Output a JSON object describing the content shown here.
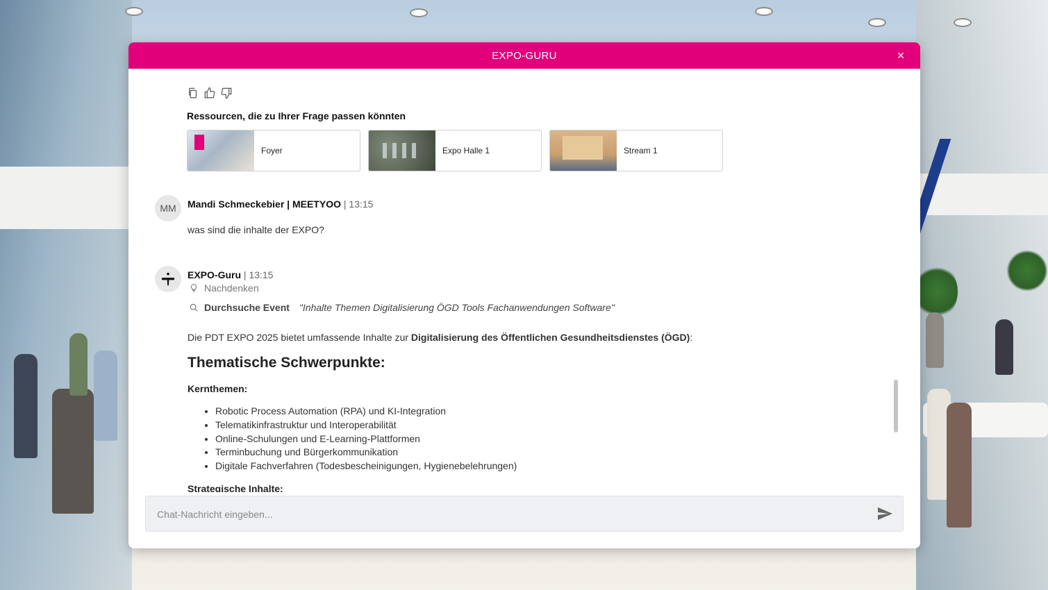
{
  "modal": {
    "title": "EXPO-GURU",
    "close_symbol": "×",
    "accent_color": "#e2007a"
  },
  "feedback_icons": [
    "copy-icon",
    "thumbs-up-icon",
    "thumbs-down-icon"
  ],
  "resources": {
    "heading": "Ressourcen, die zu Ihrer Frage passen könnten",
    "items": [
      {
        "label": "Foyer"
      },
      {
        "label": "Expo Halle 1"
      },
      {
        "label": "Stream 1"
      }
    ]
  },
  "user_message": {
    "avatar": "MM",
    "author": "Mandi Schmeckebier | MEETYOO",
    "separator": "|",
    "time": "13:15",
    "text": "was sind die inhalte der EXPO?"
  },
  "bot_message": {
    "author": "EXPO-Guru",
    "separator": "|",
    "time": "13:15",
    "steps": {
      "thinking": "Nachdenken",
      "search_label": "Durchsuche Event",
      "search_query": "\"Inhalte Themen Digitalisierung ÖGD Tools Fachanwendungen Software\""
    },
    "intro_prefix": "Die PDT EXPO 2025 bietet umfassende Inhalte zur ",
    "intro_bold": "Digitalisierung des Öffentlichen Gesundheitsdienstes (ÖGD)",
    "intro_suffix": ":",
    "heading": "Thematische Schwerpunkte:",
    "core_heading": "Kernthemen:",
    "core_items": [
      "Robotic Process Automation (RPA) und KI-Integration",
      "Telematikinfrastruktur und Interoperabilität",
      "Online-Schulungen und E-Learning-Plattformen",
      "Terminbuchung und Bürgerkommunikation",
      "Digitale Fachverfahren (Todesbescheinigungen, Hygienebelehrungen)"
    ],
    "strategic_heading": "Strategische Inhalte:"
  },
  "input": {
    "placeholder": "Chat-Nachricht eingeben...",
    "value": ""
  }
}
